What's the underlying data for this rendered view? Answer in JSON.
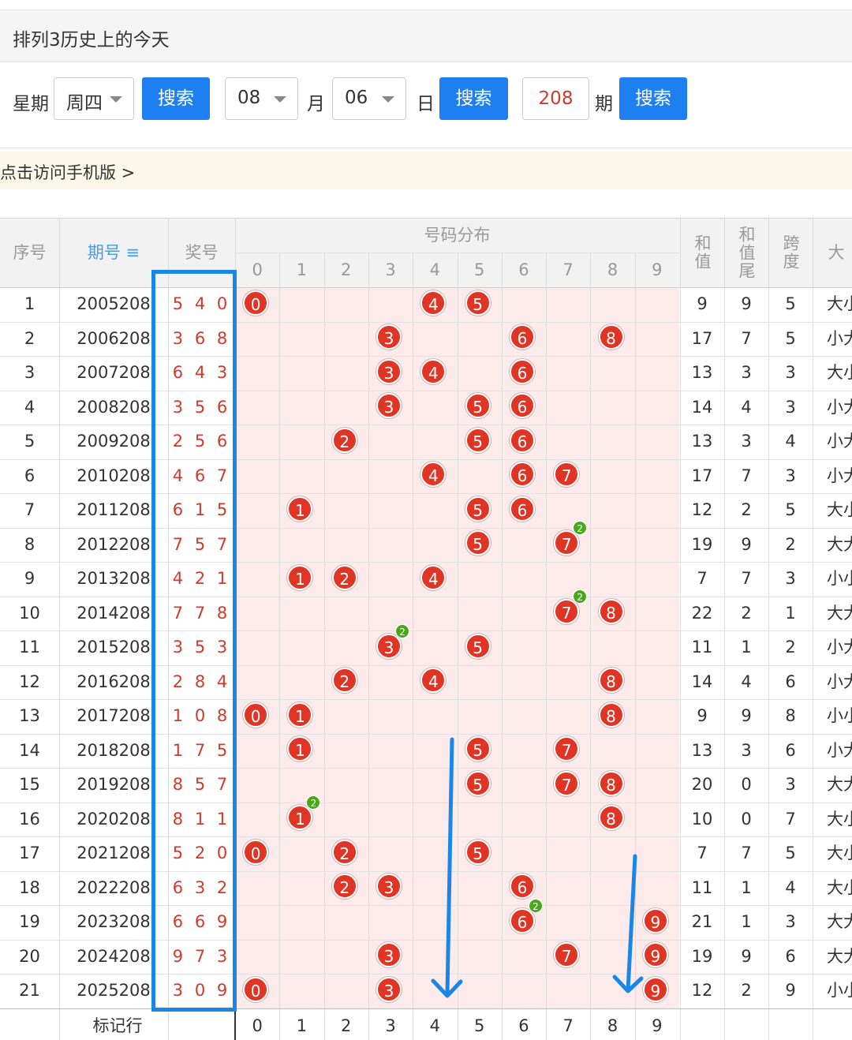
{
  "header": {
    "title": "排列3历史上的今天"
  },
  "search": {
    "week_label": "星期",
    "week_value": "周四",
    "search1": "搜索",
    "month_value": "08",
    "month_label": "月",
    "day_value": "06",
    "day_label": "日",
    "search2": "搜索",
    "period_value": "208",
    "period_label": "期",
    "search3": "搜索"
  },
  "mobile_link": "点击访问手机版 >",
  "table": {
    "col_seq": "序号",
    "col_period": "期号 ≡",
    "col_prize": "奖号",
    "col_dist": "号码分布",
    "digits": [
      "0",
      "1",
      "2",
      "3",
      "4",
      "5",
      "6",
      "7",
      "8",
      "9"
    ],
    "col_sum": "和值",
    "col_sumtail": "和值尾",
    "col_span": "跨度",
    "col_size": "大",
    "footer_label": "标记行",
    "rows": [
      {
        "seq": "1",
        "period": "2005208",
        "prize": "5 4 0",
        "nums": [
          5,
          4,
          0
        ],
        "sum": "9",
        "tail": "9",
        "span": "5",
        "size": "大小"
      },
      {
        "seq": "2",
        "period": "2006208",
        "prize": "3 6 8",
        "nums": [
          3,
          6,
          8
        ],
        "sum": "17",
        "tail": "7",
        "span": "5",
        "size": "小大"
      },
      {
        "seq": "3",
        "period": "2007208",
        "prize": "6 4 3",
        "nums": [
          6,
          4,
          3
        ],
        "sum": "13",
        "tail": "3",
        "span": "3",
        "size": "大小"
      },
      {
        "seq": "4",
        "period": "2008208",
        "prize": "3 5 6",
        "nums": [
          3,
          5,
          6
        ],
        "sum": "14",
        "tail": "4",
        "span": "3",
        "size": "小大"
      },
      {
        "seq": "5",
        "period": "2009208",
        "prize": "2 5 6",
        "nums": [
          2,
          5,
          6
        ],
        "sum": "13",
        "tail": "3",
        "span": "4",
        "size": "小大"
      },
      {
        "seq": "6",
        "period": "2010208",
        "prize": "4 6 7",
        "nums": [
          4,
          6,
          7
        ],
        "sum": "17",
        "tail": "7",
        "span": "3",
        "size": "小大"
      },
      {
        "seq": "7",
        "period": "2011208",
        "prize": "6 1 5",
        "nums": [
          6,
          1,
          5
        ],
        "sum": "12",
        "tail": "2",
        "span": "5",
        "size": "大小"
      },
      {
        "seq": "8",
        "period": "2012208",
        "prize": "7 5 7",
        "nums": [
          7,
          5,
          7
        ],
        "sum": "19",
        "tail": "9",
        "span": "2",
        "size": "大大"
      },
      {
        "seq": "9",
        "period": "2013208",
        "prize": "4 2 1",
        "nums": [
          4,
          2,
          1
        ],
        "sum": "7",
        "tail": "7",
        "span": "3",
        "size": "小小"
      },
      {
        "seq": "10",
        "period": "2014208",
        "prize": "7 7 8",
        "nums": [
          7,
          7,
          8
        ],
        "sum": "22",
        "tail": "2",
        "span": "1",
        "size": "大大"
      },
      {
        "seq": "11",
        "period": "2015208",
        "prize": "3 5 3",
        "nums": [
          3,
          5,
          3
        ],
        "sum": "11",
        "tail": "1",
        "span": "2",
        "size": "小大"
      },
      {
        "seq": "12",
        "period": "2016208",
        "prize": "2 8 4",
        "nums": [
          2,
          8,
          4
        ],
        "sum": "14",
        "tail": "4",
        "span": "6",
        "size": "小大"
      },
      {
        "seq": "13",
        "period": "2017208",
        "prize": "1 0 8",
        "nums": [
          1,
          0,
          8
        ],
        "sum": "9",
        "tail": "9",
        "span": "8",
        "size": "小小"
      },
      {
        "seq": "14",
        "period": "2018208",
        "prize": "1 7 5",
        "nums": [
          1,
          7,
          5
        ],
        "sum": "13",
        "tail": "3",
        "span": "6",
        "size": "小大"
      },
      {
        "seq": "15",
        "period": "2019208",
        "prize": "8 5 7",
        "nums": [
          8,
          5,
          7
        ],
        "sum": "20",
        "tail": "0",
        "span": "3",
        "size": "大大"
      },
      {
        "seq": "16",
        "period": "2020208",
        "prize": "8 1 1",
        "nums": [
          8,
          1,
          1
        ],
        "sum": "10",
        "tail": "0",
        "span": "7",
        "size": "大小"
      },
      {
        "seq": "17",
        "period": "2021208",
        "prize": "5 2 0",
        "nums": [
          5,
          2,
          0
        ],
        "sum": "7",
        "tail": "7",
        "span": "5",
        "size": "大小"
      },
      {
        "seq": "18",
        "period": "2022208",
        "prize": "6 3 2",
        "nums": [
          6,
          3,
          2
        ],
        "sum": "11",
        "tail": "1",
        "span": "4",
        "size": "大小"
      },
      {
        "seq": "19",
        "period": "2023208",
        "prize": "6 6 9",
        "nums": [
          6,
          6,
          9
        ],
        "sum": "21",
        "tail": "1",
        "span": "3",
        "size": "大大"
      },
      {
        "seq": "20",
        "period": "2024208",
        "prize": "9 7 3",
        "nums": [
          9,
          7,
          3
        ],
        "sum": "19",
        "tail": "9",
        "span": "6",
        "size": "大大"
      },
      {
        "seq": "21",
        "period": "2025208",
        "prize": "3 0 9",
        "nums": [
          3,
          0,
          9
        ],
        "sum": "12",
        "tail": "2",
        "span": "9",
        "size": "小小"
      }
    ]
  },
  "colors": {
    "accent": "#1e80f0",
    "ball": "#e03525",
    "repeat": "#48a81c",
    "pink": "#fdeaea",
    "annotation": "#1a87e8"
  }
}
